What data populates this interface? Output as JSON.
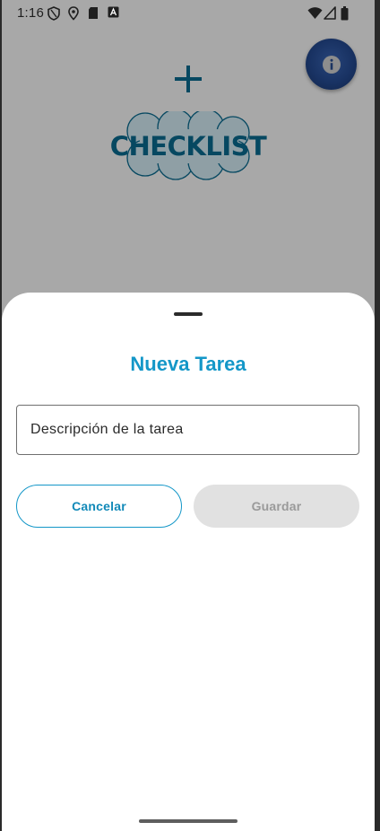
{
  "status_bar": {
    "time": "1:16",
    "icons": [
      "shield-icon",
      "location-icon",
      "sd-card-icon",
      "app-icon",
      "wifi-icon",
      "signal-icon",
      "battery-icon"
    ]
  },
  "app": {
    "logo_text": "CHECKLIST",
    "logo_icon": "plus-icon",
    "info_icon": "info-icon",
    "colors": {
      "brand": "#0a6e93",
      "fab": "#264d97"
    }
  },
  "sheet": {
    "title": "Nueva Tarea",
    "input_placeholder": "Descripción de la tarea",
    "input_value": "",
    "cancel_label": "Cancelar",
    "save_label": "Guardar",
    "colors": {
      "accent": "#1497c8",
      "disabled_bg": "#e1e1e1",
      "disabled_text": "#9a9a9a"
    }
  }
}
